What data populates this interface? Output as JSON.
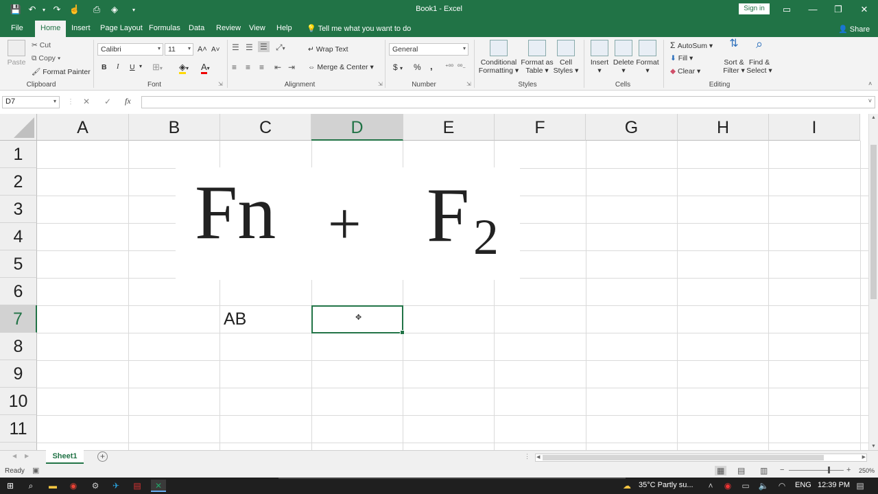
{
  "title_bar": {
    "window_title": "Book1  -  Excel",
    "sign_in": "Sign in"
  },
  "tabs": [
    "File",
    "Home",
    "Insert",
    "Page Layout",
    "Formulas",
    "Data",
    "Review",
    "View",
    "Help"
  ],
  "tell_me": "Tell me what you want to do",
  "share": "Share",
  "ribbon": {
    "clipboard": {
      "paste": "Paste",
      "cut": "Cut",
      "copy": "Copy",
      "format_painter": "Format Painter",
      "label": "Clipboard"
    },
    "font": {
      "name": "Calibri",
      "size": "11",
      "bold": "B",
      "italic": "I",
      "underline": "U",
      "label": "Font",
      "grow": "A",
      "shrink": "A"
    },
    "alignment": {
      "wrap_text": "Wrap Text",
      "merge_center": "Merge & Center",
      "label": "Alignment"
    },
    "number": {
      "format": "General",
      "currency": "$",
      "percent": "%",
      "comma": ",",
      "label": "Number"
    },
    "styles": {
      "conditional": "Conditional",
      "conditional2": "Formatting",
      "format_as": "Format as",
      "format_as2": "Table",
      "cell": "Cell",
      "cell2": "Styles",
      "label": "Styles"
    },
    "cells": {
      "insert": "Insert",
      "delete": "Delete",
      "format": "Format",
      "label": "Cells"
    },
    "editing": {
      "autosum": "AutoSum",
      "fill": "Fill",
      "clear": "Clear",
      "sort": "Sort &",
      "sort2": "Filter",
      "find": "Find &",
      "find2": "Select",
      "label": "Editing"
    }
  },
  "formula_bar": {
    "name_box": "D7",
    "cancel": "✕",
    "enter": "✓",
    "fx": "fx",
    "formula": ""
  },
  "grid": {
    "columns": [
      "A",
      "B",
      "C",
      "D",
      "E",
      "F",
      "G",
      "H",
      "I"
    ],
    "rows": [
      "1",
      "2",
      "3",
      "4",
      "5",
      "6",
      "7",
      "8",
      "9",
      "10",
      "11"
    ],
    "selected_cell": "D7",
    "cells": {
      "C7": "AB"
    }
  },
  "overlay": {
    "key1": "Fn",
    "plus": "+",
    "key2_letter": "F",
    "key2_digit": "2"
  },
  "sheet_tabs": [
    "Sheet1"
  ],
  "status": {
    "mode": "Ready",
    "zoom": "250%"
  },
  "taskbar": {
    "weather": "35°C  Partly su...",
    "lang": "ENG",
    "time": "12:39 PM"
  }
}
